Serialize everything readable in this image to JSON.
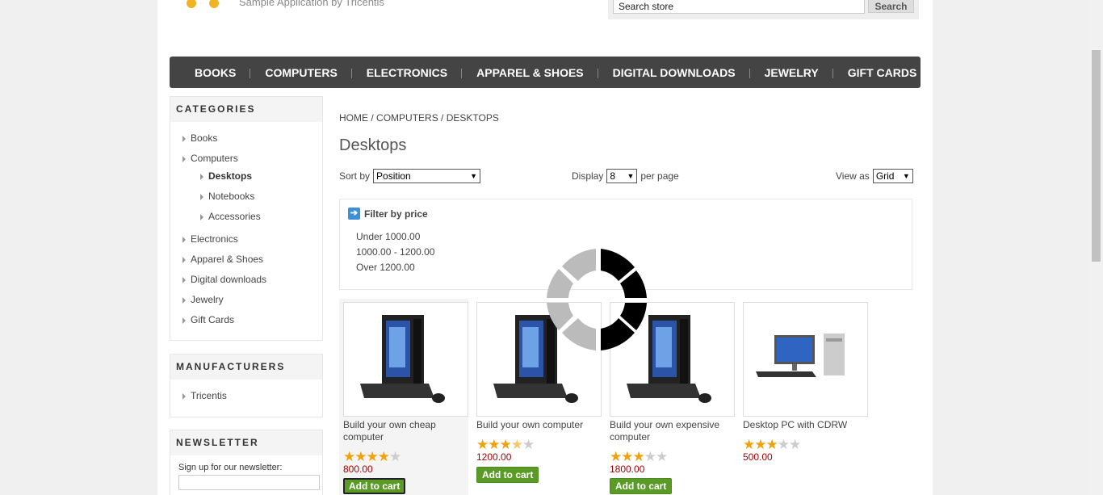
{
  "header": {
    "tagline": "Sample Application by Tricentis",
    "search_placeholder": "Search store",
    "search_button": "Search"
  },
  "topmenu": [
    "BOOKS",
    "COMPUTERS",
    "ELECTRONICS",
    "APPAREL & SHOES",
    "DIGITAL DOWNLOADS",
    "JEWELRY",
    "GIFT CARDS"
  ],
  "categories": {
    "title": "CATEGORIES",
    "items": [
      "Books",
      "Computers",
      "Desktops",
      "Notebooks",
      "Accessories",
      "Electronics",
      "Apparel & Shoes",
      "Digital downloads",
      "Jewelry",
      "Gift Cards"
    ]
  },
  "manufacturers": {
    "title": "MANUFACTURERS",
    "items": [
      "Tricentis"
    ]
  },
  "newsletter": {
    "title": "NEWSLETTER",
    "label": "Sign up for our newsletter:"
  },
  "breadcrumb": {
    "home": "HOME",
    "sep": "/",
    "computers": "COMPUTERS",
    "current": "DESKTOPS"
  },
  "page_title": "Desktops",
  "controls": {
    "sort_label": "Sort by",
    "sort_value": "Position",
    "display_label": "Display",
    "display_value": "8",
    "per_page": "per page",
    "view_label": "View as",
    "view_value": "Grid"
  },
  "filter": {
    "title": "Filter by price",
    "ranges": [
      "Under 1000.00",
      "1000.00 - 1200.00",
      "Over 1200.00"
    ]
  },
  "products": [
    {
      "name": "Build your own cheap computer",
      "rating": 4,
      "price": "800.00",
      "button": "Add to cart"
    },
    {
      "name": "Build your own computer",
      "rating": 3.5,
      "price": "1200.00",
      "button": "Add to cart"
    },
    {
      "name": "Build your own expensive computer",
      "rating": 3,
      "price": "1800.00",
      "button": "Add to cart"
    },
    {
      "name": "Desktop PC with CDRW",
      "rating": 3,
      "price": "500.00",
      "button": ""
    }
  ],
  "colors": {
    "menu_bg": "#444444",
    "price": "#9e0000",
    "cart_button": "#5a9a26",
    "star": "#f0a20c"
  }
}
